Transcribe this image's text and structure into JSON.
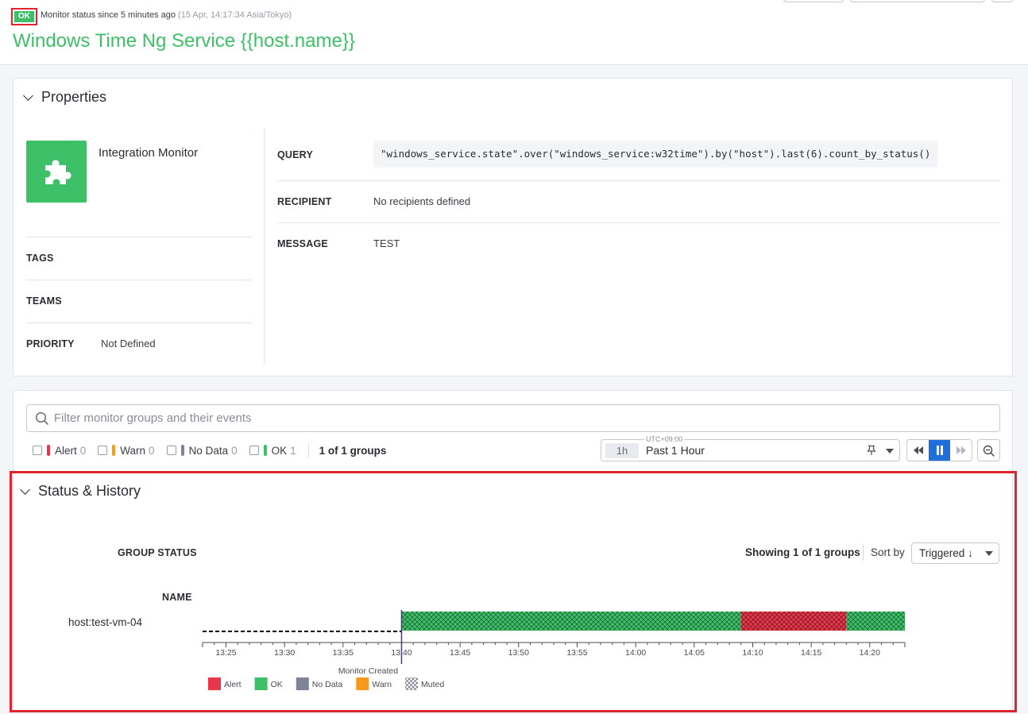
{
  "header": {
    "status_badge": "OK",
    "status_text": "Monitor status since 5 minutes ago",
    "status_timestamp": "(15 Apr, 14:17:34 Asia/Tokyo)",
    "title": "Windows Time Ng Service {{host.name}}"
  },
  "properties": {
    "section_title": "Properties",
    "monitor_type": "Integration Monitor",
    "icon": "puzzle-piece-icon",
    "tags_label": "TAGS",
    "teams_label": "TEAMS",
    "priority_label": "PRIORITY",
    "priority_value": "Not Defined",
    "query_label": "QUERY",
    "query_value": "\"windows_service.state\".over(\"windows_service:w32time\").by(\"host\").last(6).count_by_status()",
    "recipient_label": "RECIPIENT",
    "recipient_value": "No recipients defined",
    "message_label": "MESSAGE",
    "message_value": "TEST"
  },
  "filter": {
    "placeholder": "Filter monitor groups and their events",
    "facets": [
      {
        "label": "Alert",
        "count": "0",
        "color": "#e8364a"
      },
      {
        "label": "Warn",
        "count": "0",
        "color": "#f79a1b"
      },
      {
        "label": "No Data",
        "count": "0",
        "color": "#7f8399"
      },
      {
        "label": "OK",
        "count": "1",
        "color": "#3dc067"
      }
    ],
    "groups_count": "1 of 1 groups"
  },
  "time_picker": {
    "timezone": "UTC+09:00",
    "duration": "1h",
    "label": "Past 1 Hour"
  },
  "history": {
    "section_title": "Status & History",
    "group_status_label": "GROUP STATUS",
    "name_label": "NAME",
    "showing_text": "Showing 1 of 1 groups",
    "sort_by_label": "Sort by",
    "sort_value": "Triggered ↓",
    "group_name": "host:test-vm-04",
    "monitor_created_label": "Monitor Created",
    "ticks": [
      "13:25",
      "13:30",
      "13:35",
      "13:40",
      "13:45",
      "13:50",
      "13:55",
      "14:00",
      "14:05",
      "14:10",
      "14:15",
      "14:20"
    ],
    "legend": [
      {
        "label": "Alert",
        "color": "#e8364a"
      },
      {
        "label": "OK",
        "color": "#3dc067"
      },
      {
        "label": "No Data",
        "color": "#7f8399"
      },
      {
        "label": "Warn",
        "color": "#f79a1b"
      },
      {
        "label": "Muted",
        "color": "hatch"
      }
    ]
  },
  "chart_data": {
    "type": "timeline",
    "x_unit": "time (HH:MM, Asia/Tokyo)",
    "x_range": [
      "13:23",
      "14:23"
    ],
    "monitor_created": "13:40",
    "series": [
      {
        "name": "host:test-vm-04",
        "segments": [
          {
            "start": "13:40",
            "end": "14:09",
            "status": "OK",
            "muted": true
          },
          {
            "start": "14:09",
            "end": "14:18",
            "status": "Alert",
            "muted": true
          },
          {
            "start": "14:18",
            "end": "14:23",
            "status": "OK",
            "muted": true
          }
        ]
      }
    ]
  }
}
